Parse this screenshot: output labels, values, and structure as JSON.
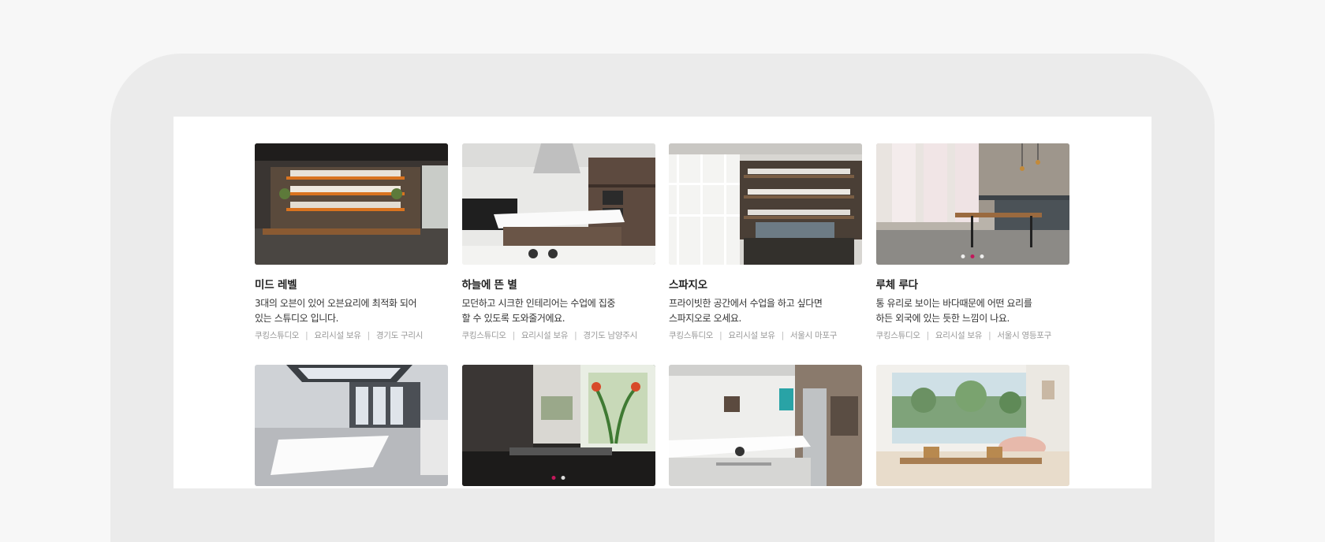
{
  "studios": [
    {
      "name": "미드 레벨",
      "description": "3대의 오븐이 있어 오븐요리에 최적화 되어\n있는 스튜디오 입니다.",
      "tags": [
        "쿠킹스튜디오",
        "요리시설 보유",
        "경기도 구리시"
      ],
      "image_icon": "kitchen-shelves-photo"
    },
    {
      "name": "하늘에 뜬 별",
      "description": "모던하고 시크한 인테리어는 수업에 집중\n할 수 있도록 도와줄거에요.",
      "tags": [
        "쿠킹스튜디오",
        "요리시설 보유",
        "경기도 남양주시"
      ],
      "image_icon": "modern-kitchen-island-photo"
    },
    {
      "name": "스파지오",
      "description": "프라이빗한 공간에서 수업을 하고 싶다면\n스파지오로 오세요.",
      "tags": [
        "쿠킹스튜디오",
        "요리시설 보유",
        "서울시 마포구"
      ],
      "image_icon": "white-shelving-kitchen-photo"
    },
    {
      "name": "루체 루다",
      "description": "통 유리로 보이는 바다때문에 어떤 요리를\n하든 외국에 있는 듯한 느낌이 나요.",
      "tags": [
        "쿠킹스튜디오",
        "요리시설 보유",
        "서울시 영등포구"
      ],
      "image_icon": "bright-loft-kitchen-photo",
      "carousel": {
        "count": 3,
        "active": 2
      }
    },
    {
      "image_icon": "skylight-dining-photo"
    },
    {
      "image_icon": "sink-window-photo",
      "carousel": {
        "count": 2,
        "active": 1
      }
    },
    {
      "image_icon": "white-kitchen-fridge-photo"
    },
    {
      "image_icon": "sunny-dining-table-photo"
    }
  ],
  "colors": {
    "accent": "#c2185b",
    "text_primary": "#222222",
    "text_meta": "#999999"
  }
}
